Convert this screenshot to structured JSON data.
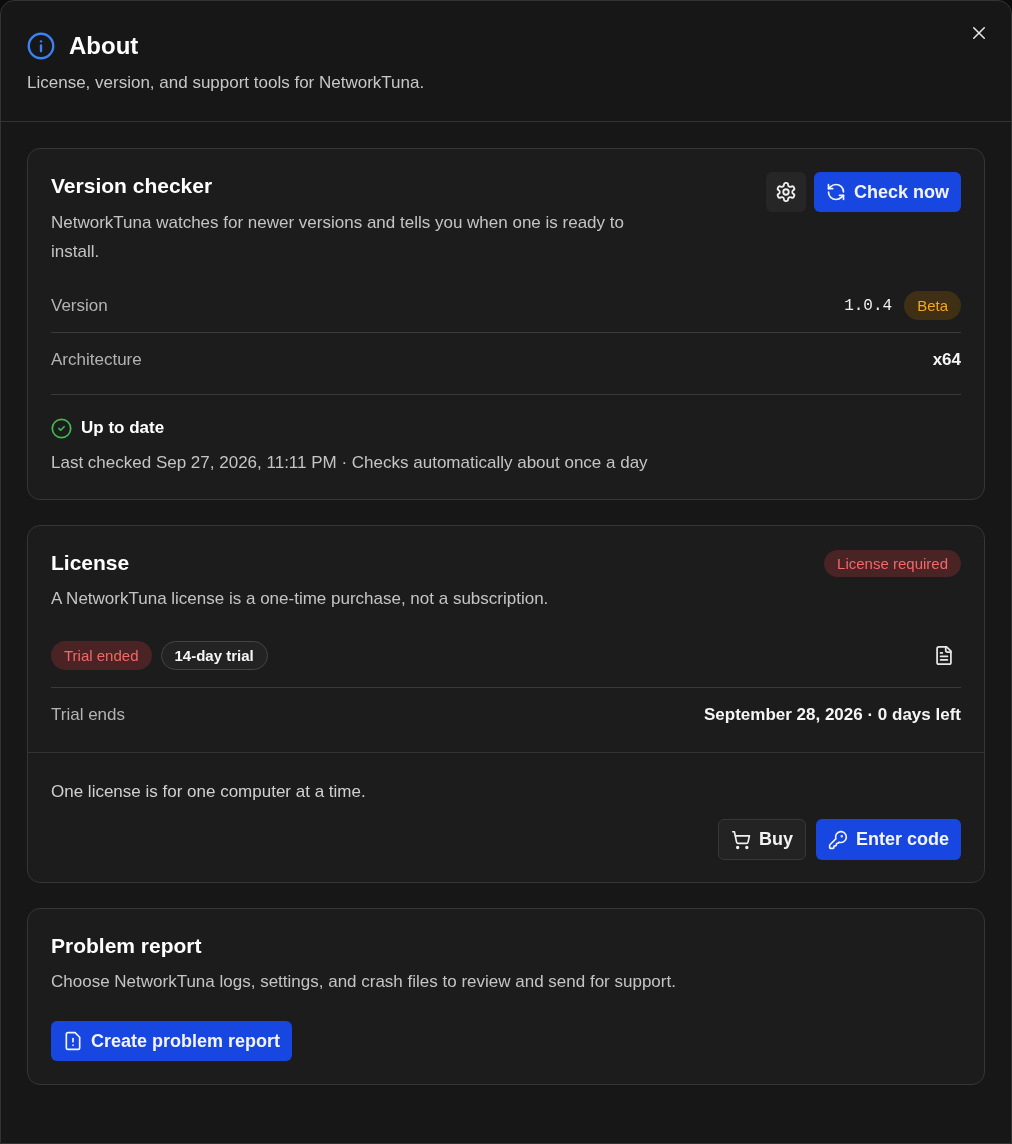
{
  "dialog": {
    "title": "About",
    "subtitle": "License, version, and support tools for NetworkTuna."
  },
  "version_checker": {
    "title": "Version checker",
    "description": "NetworkTuna watches for newer versions and tells you when one is ready to install.",
    "check_button": {
      "label": "Check now"
    },
    "rows": [
      {
        "label": "Version",
        "value": "1.0.4",
        "kind": "mono",
        "badge": {
          "label": "Beta",
          "kind": "warning"
        }
      },
      {
        "label": "Architecture",
        "value": "x64",
        "kind": "bold"
      }
    ],
    "status": {
      "label": "Up to date",
      "detail": "Last checked Sep 27, 2026, 11:11 PM · Checks automatically about once a day"
    }
  },
  "license": {
    "title": "License",
    "status_badge": {
      "label": "License required",
      "kind": "danger"
    },
    "description": "A NetworkTuna license is a one-time purchase, not a subscription.",
    "tags": [
      {
        "label": "Trial ended",
        "kind": "danger"
      },
      {
        "label": "14-day trial",
        "kind": "outline"
      }
    ],
    "rows": [
      {
        "label": "Trial ends",
        "value": "September 28, 2026 · 0 days left",
        "kind": "bold"
      }
    ],
    "note": "One license is for one computer at a time.",
    "buttons": [
      {
        "label": "Buy",
        "kind": "secondary"
      },
      {
        "label": "Enter code",
        "kind": "primary"
      }
    ]
  },
  "problem_report": {
    "title": "Problem report",
    "description": "Choose NetworkTuna logs, settings, and crash files to review and send for support.",
    "button": {
      "label": "Create problem report",
      "kind": "primary"
    }
  }
}
